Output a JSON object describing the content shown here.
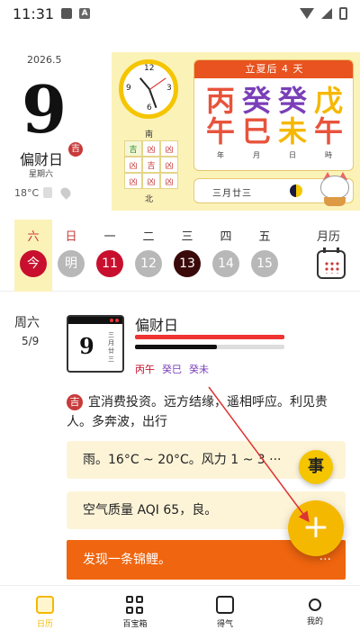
{
  "status": {
    "time": "11:31",
    "a_label": "A"
  },
  "top": {
    "year_month": "2026.5",
    "day": "9",
    "lucky_label": "偏财日",
    "ji": "吉",
    "weekday": "星期六",
    "temp": "18°C",
    "clock": {
      "n12": "12",
      "n3": "3",
      "n6": "6",
      "n9": "9"
    },
    "dir_south": "南",
    "dir_north": "北",
    "grid9": [
      "吉",
      "凶",
      "凶",
      "凶",
      "吉",
      "凶",
      "凶",
      "凶",
      "凶"
    ],
    "solar_term": "立夏后 4 天",
    "pillars": [
      {
        "top": "丙",
        "bottom": "午",
        "label": "年",
        "top_color": "#e8533b",
        "bottom_color": "#e8533b"
      },
      {
        "top": "癸",
        "bottom": "巳",
        "label": "月",
        "top_color": "#7a3fb8",
        "bottom_color": "#e8533b"
      },
      {
        "top": "癸",
        "bottom": "未",
        "label": "日",
        "top_color": "#7a3fb8",
        "bottom_color": "#f5b800"
      },
      {
        "top": "戊",
        "bottom": "午",
        "label": "時",
        "top_color": "#f5b800",
        "bottom_color": "#e8533b"
      }
    ],
    "lunar": "三月廿三"
  },
  "week": {
    "days": [
      {
        "label": "六",
        "num": "今",
        "red": true,
        "color": "#c8102e"
      },
      {
        "label": "日",
        "num": "明",
        "red": true,
        "color": "#b8b8b8"
      },
      {
        "label": "一",
        "num": "11",
        "red": false,
        "color": "#c8102e"
      },
      {
        "label": "二",
        "num": "12",
        "red": false,
        "color": "#b8b8b8"
      },
      {
        "label": "三",
        "num": "13",
        "red": false,
        "color": "#3a0a0a"
      },
      {
        "label": "四",
        "num": "14",
        "red": false,
        "color": "#b8b8b8"
      },
      {
        "label": "五",
        "num": "15",
        "red": false,
        "color": "#b8b8b8"
      }
    ],
    "month_label": "月历"
  },
  "detail": {
    "weekday": "周六",
    "date": "5/9",
    "mini_day": "9",
    "mini_lunar": "三月廿三",
    "luck_title": "偏财日",
    "luck_level": 0.55,
    "ganzhi": [
      {
        "text": "丙午",
        "color": "#c8102e"
      },
      {
        "text": "癸巳",
        "color": "#7a3fb8"
      },
      {
        "text": "癸未",
        "color": "#7a3fb8"
      }
    ],
    "advice_badge": "吉",
    "advice": "宜消费投资。远方结缘，遥相呼应。利见贵人。多奔波，出行",
    "weather": "雨。16°C ~ 20°C。风力 1 ~ 3 ···",
    "air": "空气质量 AQI 65，良。",
    "fish": "发现一条锦鲤。",
    "more": "···"
  },
  "fab": {
    "shi": "事",
    "plus": "+"
  },
  "nav": [
    {
      "label": "日历",
      "active": true
    },
    {
      "label": "百宝箱",
      "active": false
    },
    {
      "label": "得气",
      "active": false
    },
    {
      "label": "我的",
      "active": false
    }
  ]
}
